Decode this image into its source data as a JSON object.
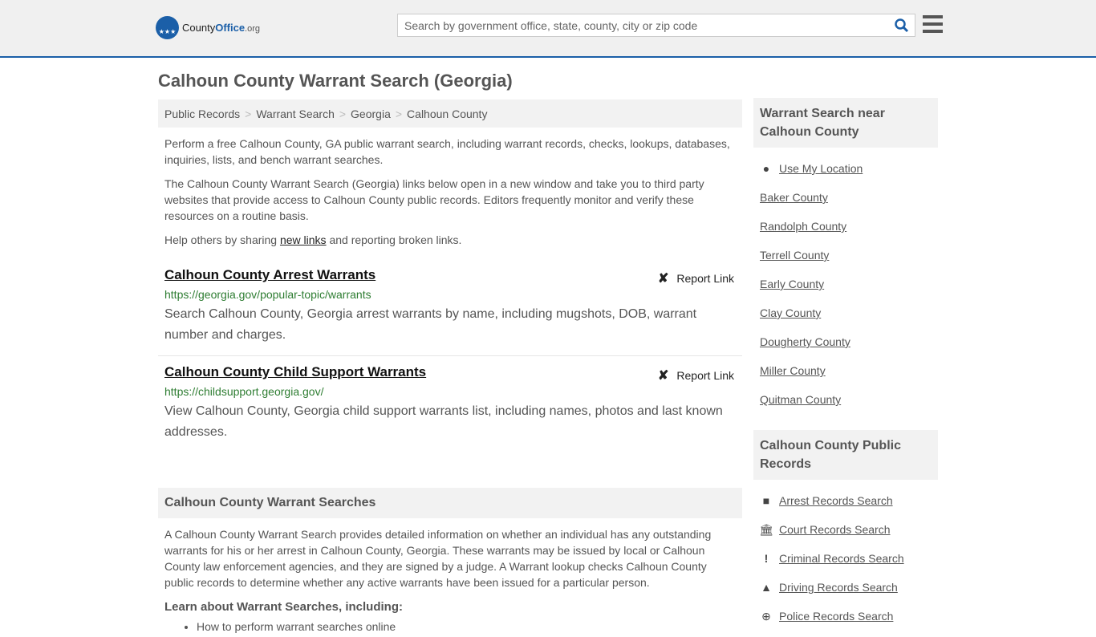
{
  "header": {
    "logo_county": "County",
    "logo_office": "Office",
    "logo_org": ".org",
    "search_placeholder": "Search by government office, state, county, city or zip code"
  },
  "page_title": "Calhoun County Warrant Search (Georgia)",
  "breadcrumb": [
    "Public Records",
    "Warrant Search",
    "Georgia",
    "Calhoun County"
  ],
  "intro": {
    "p1": "Perform a free Calhoun County, GA public warrant search, including warrant records, checks, lookups, databases, inquiries, lists, and bench warrant searches.",
    "p2": "The Calhoun County Warrant Search (Georgia) links below open in a new window and take you to third party websites that provide access to Calhoun County public records. Editors frequently monitor and verify these resources on a routine basis.",
    "p3_pre": "Help others by sharing ",
    "p3_link": "new links",
    "p3_post": " and reporting broken links."
  },
  "results": [
    {
      "title": "Calhoun County Arrest Warrants",
      "url": "https://georgia.gov/popular-topic/warrants",
      "desc": "Search Calhoun County, Georgia arrest warrants by name, including mugshots, DOB, warrant number and charges.",
      "report": "Report Link"
    },
    {
      "title": "Calhoun County Child Support Warrants",
      "url": "https://childsupport.georgia.gov/",
      "desc": "View Calhoun County, Georgia child support warrants list, including names, photos and last known addresses.",
      "report": "Report Link"
    }
  ],
  "section": {
    "title": "Calhoun County Warrant Searches",
    "body": "A Calhoun County Warrant Search provides detailed information on whether an individual has any outstanding warrants for his or her arrest in Calhoun County, Georgia. These warrants may be issued by local or Calhoun County law enforcement agencies, and they are signed by a judge. A Warrant lookup checks Calhoun County public records to determine whether any active warrants have been issued for a particular person.",
    "learn": "Learn about Warrant Searches, including:",
    "bullets": [
      "How to perform warrant searches online"
    ]
  },
  "sidebar": {
    "nearby_title": "Warrant Search near Calhoun County",
    "use_location": "Use My Location",
    "nearby": [
      "Baker County",
      "Randolph County",
      "Terrell County",
      "Early County",
      "Clay County",
      "Dougherty County",
      "Miller County",
      "Quitman County"
    ],
    "records_title": "Calhoun County Public Records",
    "records": [
      {
        "label": "Arrest Records Search",
        "icon": "arrest-icon"
      },
      {
        "label": "Court Records Search",
        "icon": "court-icon"
      },
      {
        "label": "Criminal Records Search",
        "icon": "exclamation-icon"
      },
      {
        "label": "Driving Records Search",
        "icon": "car-icon"
      },
      {
        "label": "Police Records Search",
        "icon": "police-icon"
      }
    ]
  }
}
